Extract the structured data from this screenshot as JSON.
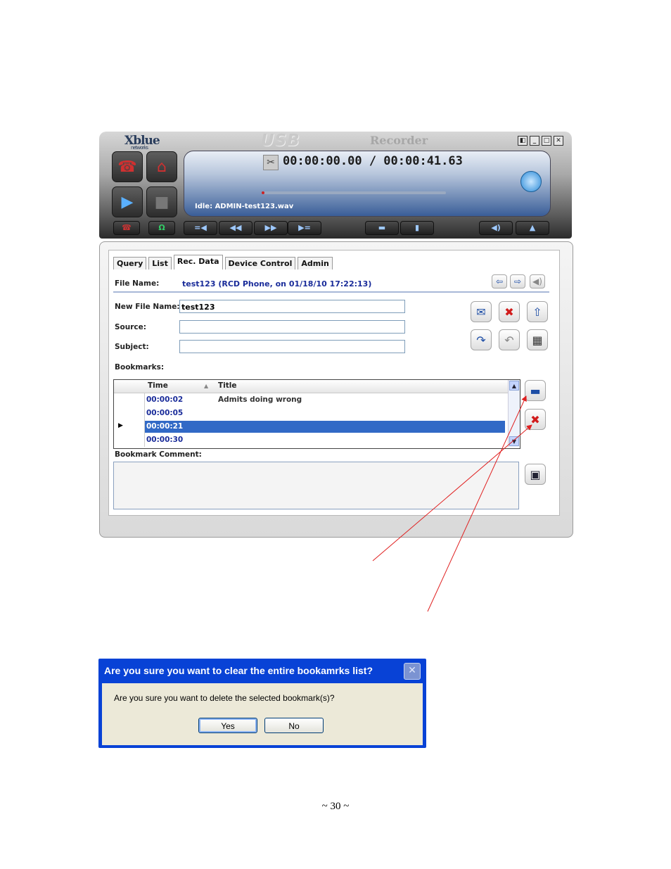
{
  "recorder": {
    "brand": "Xblue",
    "brand_sub": "networks",
    "usb_label": "USB",
    "title": "Recorder",
    "timecode": "00:00:00.00 / 00:00:41.63",
    "status": "Idle: ADMIN-test123.wav",
    "progress_fraction": 0.0
  },
  "tabs": [
    "Query",
    "List",
    "Rec. Data",
    "Device Control",
    "Admin"
  ],
  "form": {
    "file_name_label": "File Name:",
    "file_name_value": "test123 (RCD Phone, on 01/18/10 17:22:13)",
    "new_file_name_label": "New File Name:",
    "new_file_name_value": "test123",
    "source_label": "Source:",
    "source_value": "",
    "subject_label": "Subject:",
    "subject_value": "",
    "bookmarks_label": "Bookmarks:",
    "bookmark_comment_label": "Bookmark Comment:"
  },
  "bookmarks": {
    "columns": [
      "Time",
      "Title"
    ],
    "rows": [
      {
        "time": "00:00:02",
        "title": "Admits doing wrong"
      },
      {
        "time": "00:00:05",
        "title": ""
      },
      {
        "time": "00:00:21",
        "title": ""
      },
      {
        "time": "00:00:30",
        "title": ""
      }
    ],
    "selected_index": 2
  },
  "dialog": {
    "title": "Are you sure you want to clear the entire bookamrks list?",
    "message": "Are you sure you want to delete the selected bookmark(s)?",
    "yes": "Yes",
    "no": "No",
    "close_glyph": "✕"
  },
  "page_number": "~ 30 ~",
  "colors": {
    "link_blue": "#1a2c9a",
    "selection": "#3169c6",
    "dialog_title_bar": "#0842d6",
    "arrow": "#e02020"
  }
}
